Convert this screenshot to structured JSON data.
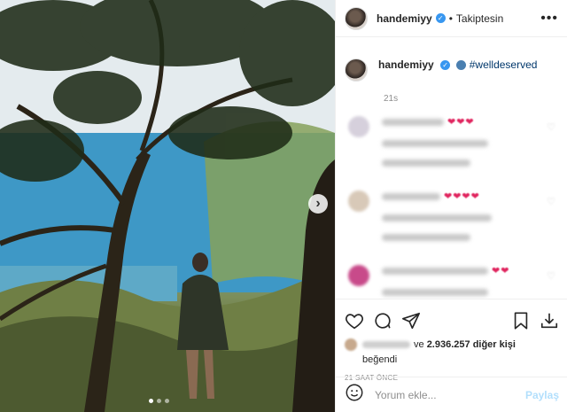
{
  "post": {
    "username": "handemiyy",
    "follow_status": "Takiptesin",
    "caption_hashtag": "#welldeserved",
    "caption_time": "21s"
  },
  "comments": [
    {
      "hearts": "❤❤❤"
    },
    {
      "hearts": "❤❤❤❤"
    },
    {
      "hearts": "❤❤"
    }
  ],
  "likes": {
    "connector": "ve",
    "count": "2.936.257",
    "suffix": "diğer kişi",
    "liked_label": "beğendi"
  },
  "timestamp": "21 SAAT ÖNCE",
  "comment_box": {
    "placeholder": "Yorum ekle...",
    "submit_label": "Paylaş"
  },
  "icons": {
    "verified": "verified-badge-icon",
    "more": "more-options-icon",
    "next": "chevron-right-icon",
    "like": "heart-icon",
    "comment": "comment-icon",
    "share": "send-icon",
    "save": "bookmark-icon",
    "download": "download-icon",
    "emoji": "emoji-icon"
  },
  "colors": {
    "verified": "#3897f0",
    "hashtag": "#00376b",
    "muted": "#8e8e8e",
    "share_disabled": "#b2dffc"
  }
}
